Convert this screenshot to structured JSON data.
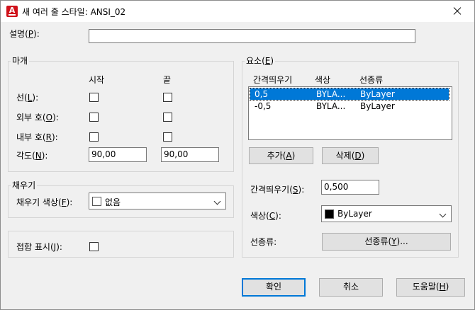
{
  "window": {
    "title": "새 여러 줄 스타일: ANSI_02",
    "app_icon_letter": "A"
  },
  "description": {
    "label": "설명(",
    "mnemonic": "P",
    "label_end": "):",
    "value": ""
  },
  "caps": {
    "title": "마개",
    "col_start": "시작",
    "col_end": "끝",
    "rows": [
      {
        "label": "선(",
        "mnemonic": "L",
        "end": "):"
      },
      {
        "label": "외부 호(",
        "mnemonic": "O",
        "end": "):"
      },
      {
        "label": "내부 호(",
        "mnemonic": "R",
        "end": "):"
      },
      {
        "label": "각도(",
        "mnemonic": "N",
        "end": "):"
      }
    ],
    "angle_start": "90,00",
    "angle_end": "90,00"
  },
  "fill": {
    "title": "채우기",
    "label": "채우기 색상(",
    "mnemonic": "F",
    "end": "):",
    "value": "없음"
  },
  "joints": {
    "label": "접합 표시(",
    "mnemonic": "J",
    "end": "):"
  },
  "elements": {
    "title": "요소(",
    "mnemonic": "E",
    "title_end": ")",
    "headers": [
      "간격띄우기",
      "색상",
      "선종류"
    ],
    "rows": [
      {
        "offset": "0,5",
        "color": "BYLA...",
        "linetype": "ByLayer",
        "selected": true
      },
      {
        "offset": "-0,5",
        "color": "BYLA...",
        "linetype": "ByLayer",
        "selected": false
      }
    ],
    "add_button": {
      "label": "추가(",
      "mnemonic": "A",
      "end": ")"
    },
    "delete_button": {
      "label": "삭제(",
      "mnemonic": "D",
      "end": ")"
    },
    "offset_label": "간격띄우기(",
    "offset_mnemonic": "S",
    "offset_end": "):",
    "offset_value": "0,500",
    "color_label": "색상(",
    "color_mnemonic": "C",
    "color_end": "):",
    "color_value": "ByLayer",
    "color_swatch": "#000000",
    "linetype_label": "선종류:",
    "linetype_button": {
      "label": "선종류(",
      "mnemonic": "Y",
      "end": ")..."
    }
  },
  "footer": {
    "ok": "확인",
    "cancel": "취소",
    "help": {
      "label": "도움말(",
      "mnemonic": "H",
      "end": ")"
    }
  },
  "colors": {
    "accent": "#0078d7",
    "brand": "#d0121b"
  }
}
